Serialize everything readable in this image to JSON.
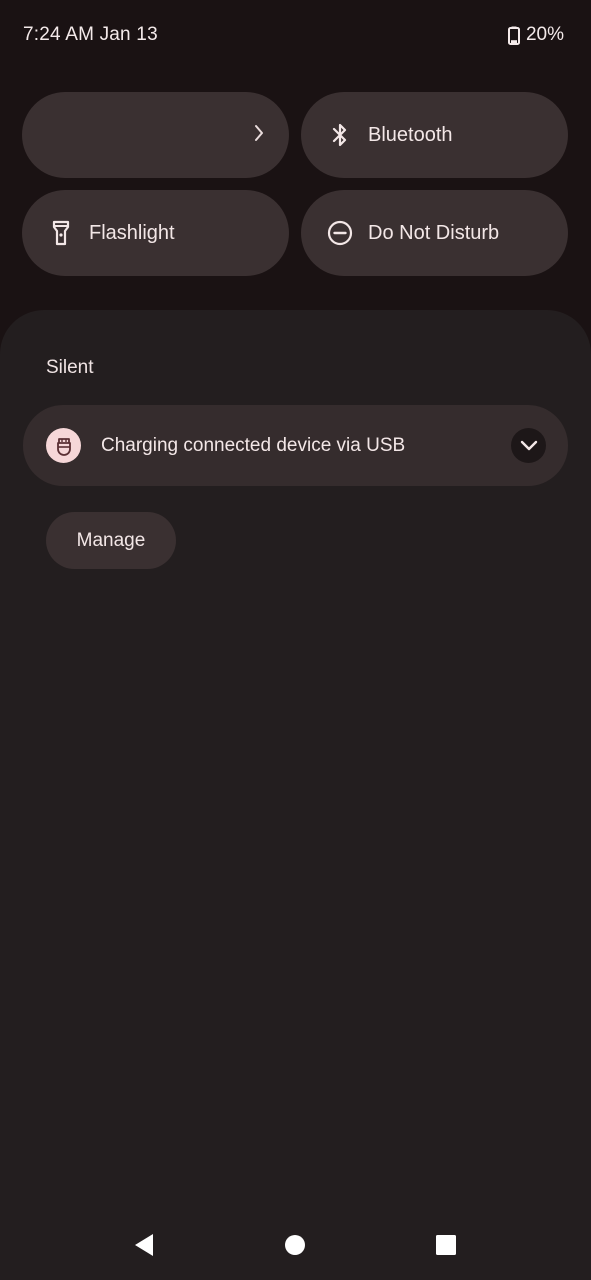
{
  "status_bar": {
    "time_date": "7:24 AM Jan 13",
    "battery_percent": "20%",
    "battery_level": 0.2,
    "battery_icon": "battery-icon"
  },
  "quick_tiles": [
    {
      "label": "",
      "icon": "chevron-right-icon"
    },
    {
      "label": "Bluetooth",
      "icon": "bluetooth-icon"
    },
    {
      "label": "Flashlight",
      "icon": "flashlight-icon"
    },
    {
      "label": "Do Not Disturb",
      "icon": "do-not-disturb-icon"
    }
  ],
  "notifications": {
    "section_title": "Silent",
    "items": [
      {
        "text": "Charging connected device via USB",
        "icon": "usb-icon",
        "expand_icon": "chevron-down-icon"
      }
    ],
    "manage_label": "Manage"
  },
  "nav_bar": {
    "back_icon": "back-icon",
    "home_icon": "home-icon",
    "recents_icon": "recents-icon"
  },
  "colors": {
    "background": "#1a1213",
    "tile": "#3a3031",
    "shade": "#231e1f",
    "notification_card": "#352c2d",
    "app_icon_bg": "#f6d7d8",
    "text": "#f3e7e7"
  }
}
